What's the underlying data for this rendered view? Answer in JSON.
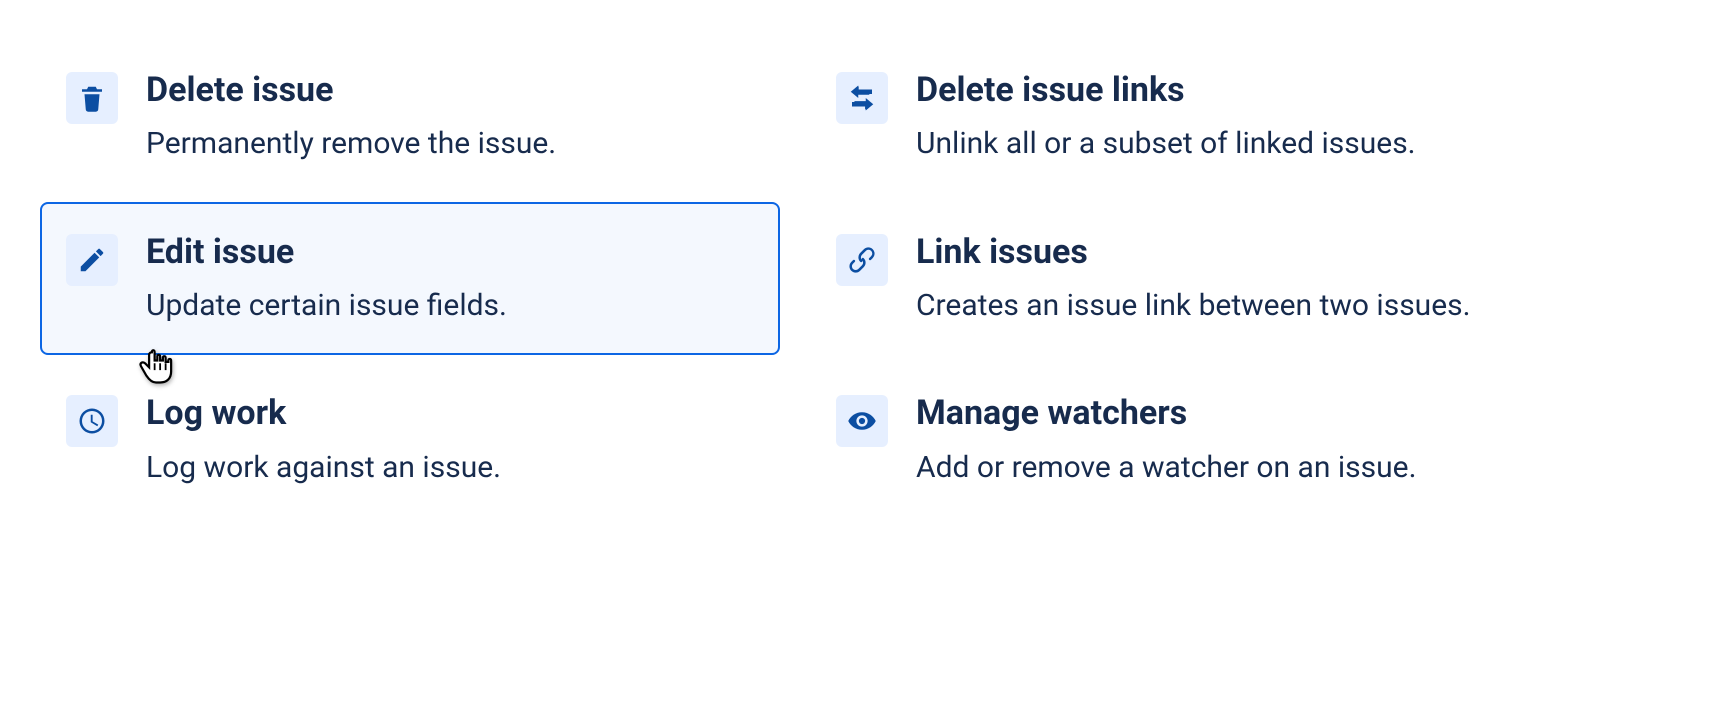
{
  "left": [
    {
      "title": "Delete issue",
      "desc": "Permanently remove the issue.",
      "selected": false,
      "icon": "trash"
    },
    {
      "title": "Edit issue",
      "desc": "Update certain issue fields.",
      "selected": true,
      "icon": "pencil"
    },
    {
      "title": "Log work",
      "desc": "Log work against an issue.",
      "selected": false,
      "icon": "clock"
    }
  ],
  "right": [
    {
      "title": "Delete issue links",
      "desc": "Unlink all or a subset of linked issues.",
      "selected": false,
      "icon": "swap"
    },
    {
      "title": "Link issues",
      "desc": "Creates an issue link between two issues.",
      "selected": false,
      "icon": "link"
    },
    {
      "title": "Manage watchers",
      "desc": "Add or remove a watcher on an issue.",
      "selected": false,
      "icon": "eye"
    }
  ]
}
